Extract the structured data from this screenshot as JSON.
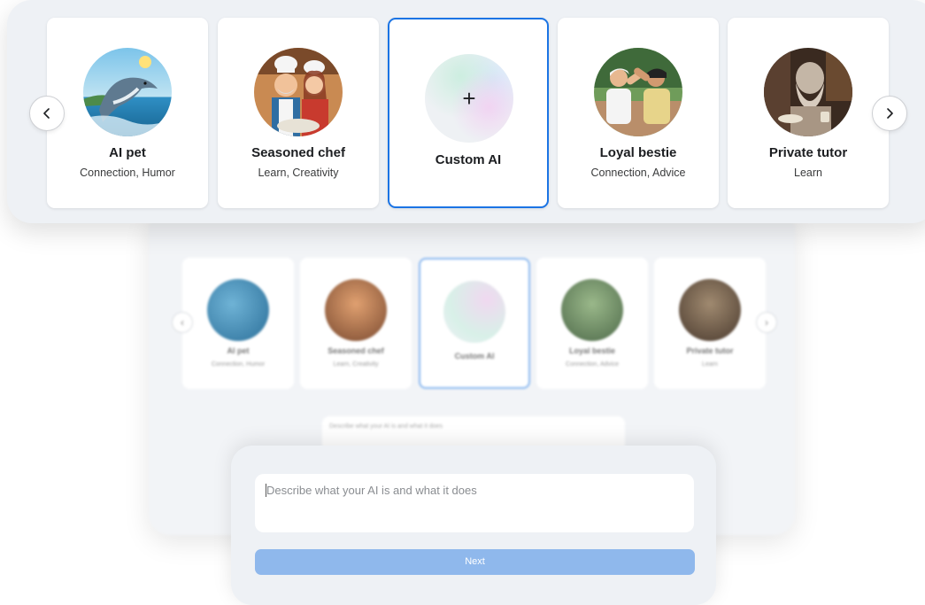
{
  "cards": [
    {
      "name": "AI pet",
      "tags": "Connection, Humor"
    },
    {
      "name": "Seasoned chef",
      "tags": "Learn, Creativity"
    },
    {
      "name": "Custom AI",
      "tags": ""
    },
    {
      "name": "Loyal bestie",
      "tags": "Connection, Advice"
    },
    {
      "name": "Private tutor",
      "tags": "Learn"
    }
  ],
  "custom_symbol": "+",
  "nav": {
    "prev_icon": "chevron-left-icon",
    "next_icon": "chevron-right-icon"
  },
  "describe": {
    "placeholder": "Describe what your AI is and what it does",
    "next_label": "Next"
  },
  "colors": {
    "selected_border": "#1b74e4",
    "next_button": "#8fb8ec",
    "panel": "#eef1f5"
  }
}
